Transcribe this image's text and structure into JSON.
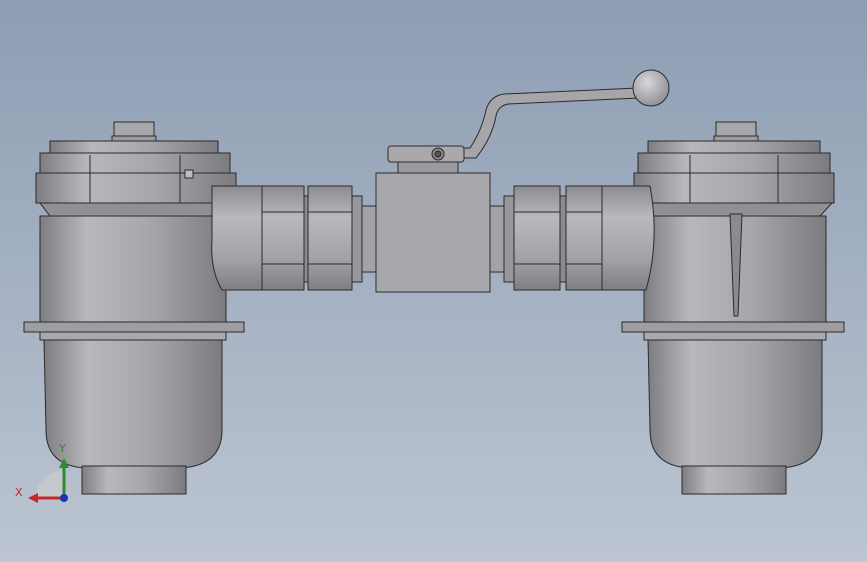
{
  "triad": {
    "x_label": "X",
    "y_label": "Y",
    "x_color": "#c62828",
    "y_color": "#2e8b2e",
    "z_color": "#1f2fb8"
  },
  "model": {
    "body_fill": "#a9a9ad",
    "dark_fill": "#9a9a9e",
    "outline": "#2b2b2b"
  }
}
